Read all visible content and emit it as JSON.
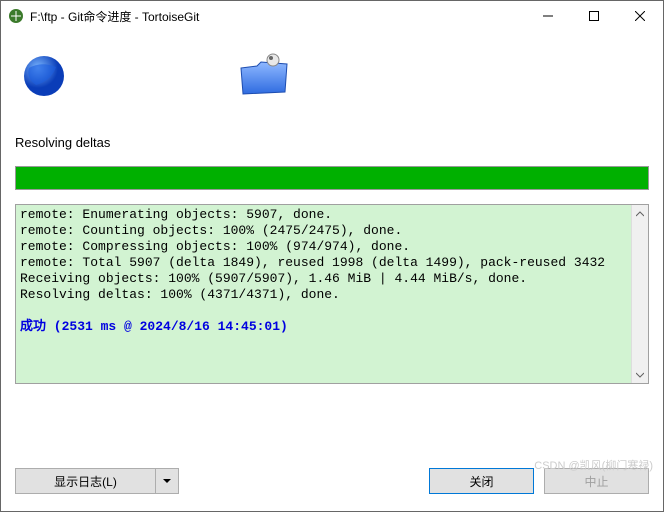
{
  "window": {
    "title": "F:\\ftp - Git命令进度 - TortoiseGit"
  },
  "status": {
    "label": "Resolving deltas"
  },
  "log": {
    "lines": [
      "remote: Enumerating objects: 5907, done.",
      "remote: Counting objects: 100% (2475/2475), done.",
      "remote: Compressing objects: 100% (974/974), done.",
      "remote: Total 5907 (delta 1849), reused 1998 (delta 1499), pack-reused 3432",
      "Receiving objects: 100% (5907/5907), 1.46 MiB | 4.44 MiB/s, done.",
      "Resolving deltas: 100% (4371/4371), done."
    ],
    "success": "成功 (2531 ms @ 2024/8/16 14:45:01)"
  },
  "buttons": {
    "show_log": "显示日志(L)",
    "close": "关闭",
    "abort": "中止"
  },
  "watermark": "CSDN @凯风(柳门寒禄)"
}
